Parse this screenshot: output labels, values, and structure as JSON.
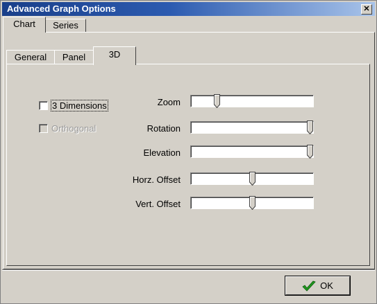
{
  "window": {
    "title": "Advanced Graph Options",
    "close_glyph": "✕"
  },
  "outer_tabs": [
    {
      "label": "Chart",
      "active": true
    },
    {
      "label": "Series",
      "active": false
    }
  ],
  "inner_tabs": [
    {
      "label": "General",
      "active": false
    },
    {
      "label": "Panel",
      "active": false
    },
    {
      "label": "3D",
      "active": true
    }
  ],
  "checkboxes": {
    "three_d": {
      "label": "3 Dimensions",
      "checked": false,
      "enabled": true
    },
    "orthogonal": {
      "label": "Orthogonal",
      "checked": false,
      "enabled": false
    }
  },
  "sliders": [
    {
      "label": "Zoom",
      "value": 0.2
    },
    {
      "label": "Rotation",
      "value": 1.0
    },
    {
      "label": "Elevation",
      "value": 1.0
    },
    {
      "label": "Horz. Offset",
      "value": 0.5
    },
    {
      "label": "Vert. Offset",
      "value": 0.5
    }
  ],
  "buttons": {
    "ok_label": "OK",
    "ok_icon": "checkmark-icon"
  },
  "colors": {
    "title_start": "#1a3f8a",
    "title_end": "#a9c4ea",
    "check_green": "#1f9a1f"
  }
}
